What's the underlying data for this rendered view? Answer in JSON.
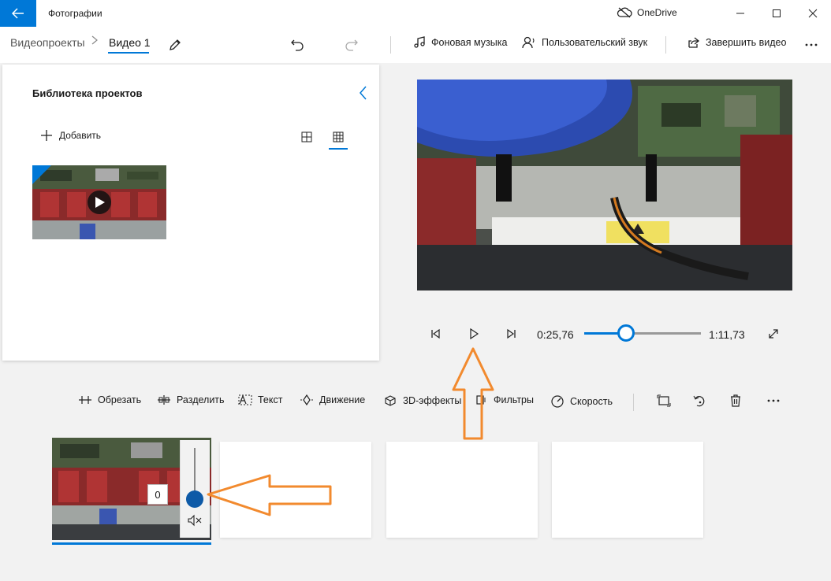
{
  "app": {
    "title": "Фотографии",
    "onedrive_label": "OneDrive"
  },
  "breadcrumb": {
    "parent": "Видеопроекты",
    "current": "Видео 1"
  },
  "toolbar": {
    "background_music": "Фоновая музыка",
    "custom_audio": "Пользовательский звук",
    "finish_video": "Завершить видео"
  },
  "library": {
    "title": "Библиотека проектов",
    "add_label": "Добавить"
  },
  "player": {
    "current_time": "0:25,76",
    "total_time": "1:11,73",
    "progress": 0.36
  },
  "storyboard": {
    "tools": [
      "Обрезать",
      "Разделить",
      "Текст",
      "Движение",
      "3D-эффекты",
      "Фильтры",
      "Скорость"
    ],
    "volume_value": "0"
  },
  "colors": {
    "accent": "#0078d7",
    "annotation": "#f28a2e"
  }
}
